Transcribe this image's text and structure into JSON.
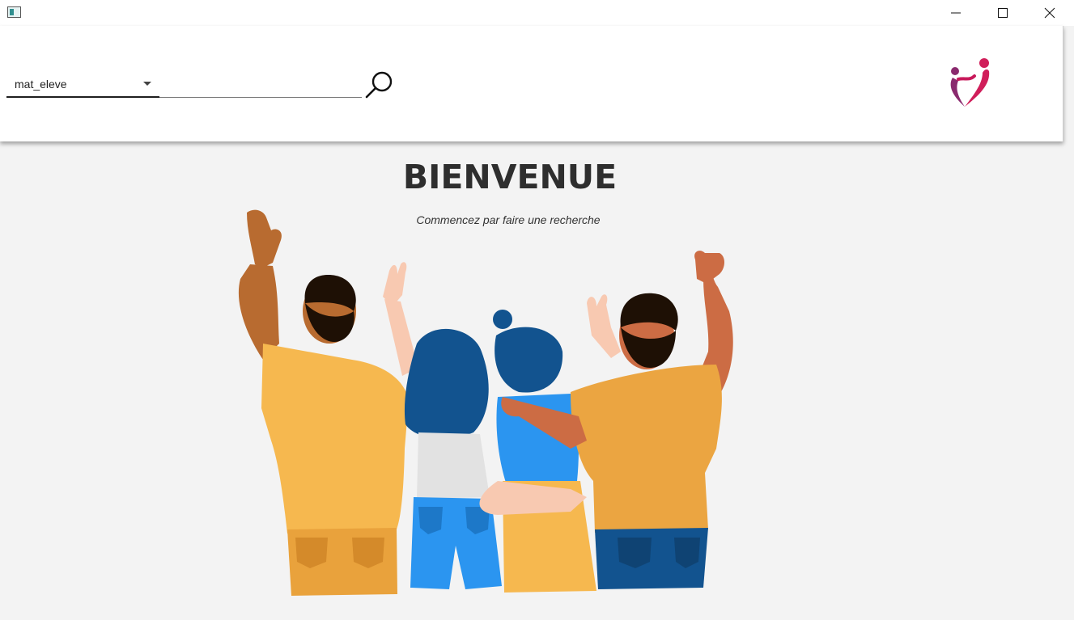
{
  "window": {
    "icon": "app-window-icon",
    "controls": [
      "minimize-icon",
      "maximize-icon",
      "close-icon"
    ]
  },
  "search": {
    "field_selected": "mat_eleve",
    "value": "",
    "placeholder": "",
    "icon": "search-icon"
  },
  "logo": {
    "icon": "heart-people-logo"
  },
  "welcome": {
    "title": "BIENVENUE",
    "subtitle": "Commencez par faire une recherche"
  },
  "illustration": {
    "icon": "group-of-friends-illustration"
  },
  "colors": {
    "background": "#f3f3f3",
    "header": "#ffffff",
    "logo_pink": "#c8195a",
    "logo_purple": "#7a2a6a",
    "shirt_yellow": "#f5b54a",
    "hair_blue": "#12538f",
    "jeans_blue": "#2b95f0"
  }
}
